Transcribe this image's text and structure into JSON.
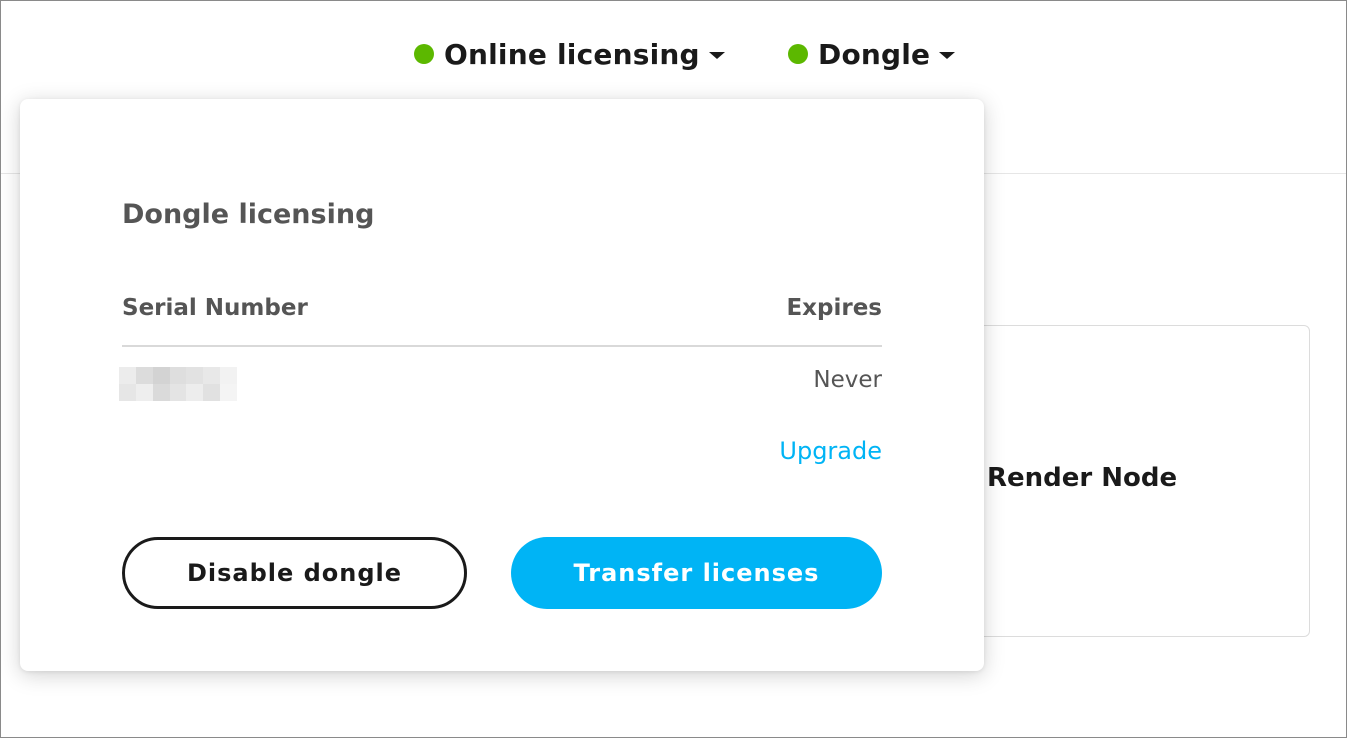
{
  "colors": {
    "status_online": "#5cb800",
    "accent": "#00b4f5",
    "text_dark": "#1a1a1a",
    "text_muted": "#555555"
  },
  "header": {
    "online_menu": {
      "label": "Online licensing",
      "status": "active",
      "icon": "status-dot-icon"
    },
    "dongle_menu": {
      "label": "Dongle",
      "status": "active",
      "icon": "status-dot-icon"
    }
  },
  "background_card": {
    "title": "Render Node"
  },
  "dongle_panel": {
    "title": "Dongle licensing",
    "columns": {
      "serial": "Serial Number",
      "expires": "Expires"
    },
    "rows": [
      {
        "serial": "",
        "serial_redacted": true,
        "expires": "Never"
      }
    ],
    "upgrade_link": "Upgrade",
    "buttons": {
      "disable": "Disable dongle",
      "transfer": "Transfer licenses"
    }
  }
}
